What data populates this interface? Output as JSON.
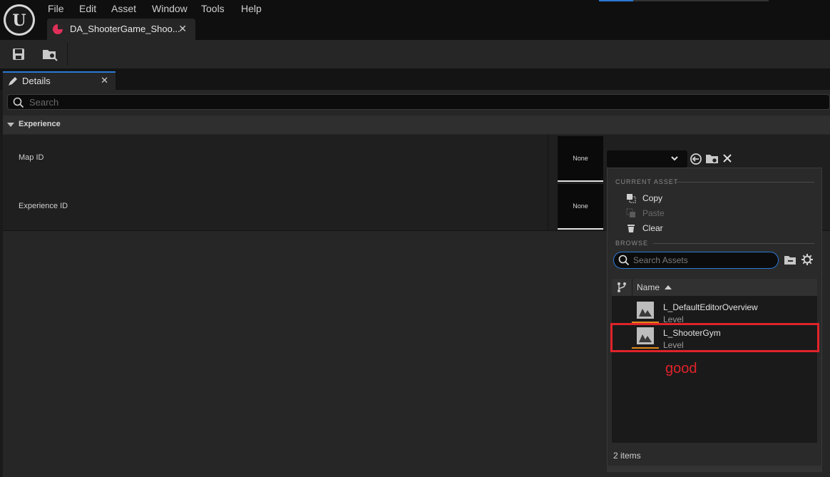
{
  "menubar": {
    "items": [
      "File",
      "Edit",
      "Asset",
      "Window",
      "Tools",
      "Help"
    ]
  },
  "doc_tab": {
    "title": "DA_ShooterGame_Shoo..."
  },
  "details_tab": {
    "title": "Details"
  },
  "search": {
    "placeholder": "Search"
  },
  "category": {
    "label": "Experience"
  },
  "properties": [
    {
      "label": "Map ID",
      "value": "None"
    },
    {
      "label": "Experience ID",
      "value": "None"
    }
  ],
  "asset_menu": {
    "current_asset_header": "CURRENT ASSET",
    "copy": "Copy",
    "paste": "Paste",
    "clear": "Clear",
    "browse_header": "BROWSE",
    "search_placeholder": "Search Assets",
    "column_name": "Name",
    "assets": [
      {
        "name": "L_DefaultEditorOverview",
        "type": "Level"
      },
      {
        "name": "L_ShooterGym",
        "type": "Level"
      }
    ],
    "count": "2 items"
  },
  "annotation": {
    "text": "good",
    "color": "#e0232a"
  },
  "colors": {
    "accent": "#2b79d4",
    "asset_underline": "#e08a1a",
    "tab_icon": "#e0305a"
  }
}
